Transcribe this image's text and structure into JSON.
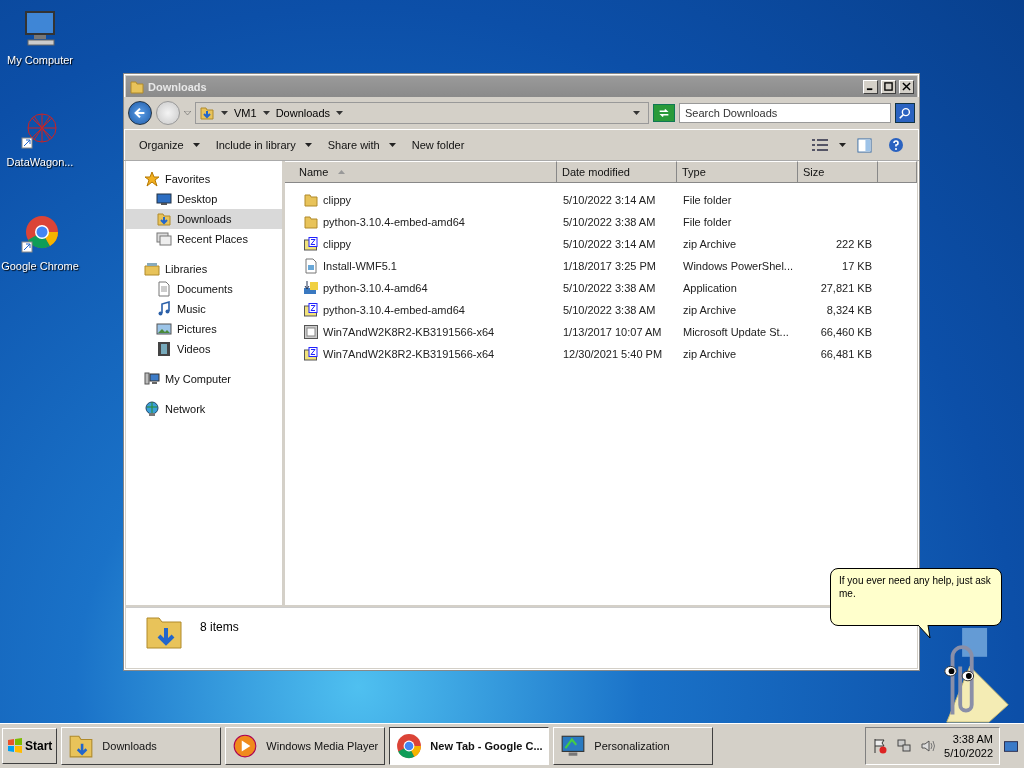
{
  "desktop_icons": [
    {
      "label": "My Computer",
      "kind": "computer"
    },
    {
      "label": "DataWagon...",
      "kind": "network-art"
    },
    {
      "label": "Google Chrome",
      "kind": "browser"
    }
  ],
  "window": {
    "title": "Downloads",
    "address": [
      "VM1",
      "Downloads"
    ],
    "search": {
      "placeholder": "Search Downloads"
    }
  },
  "toolbar": [
    {
      "label": "Organize",
      "dropdown": true
    },
    {
      "label": "Include in library",
      "dropdown": true
    },
    {
      "label": "Share with",
      "dropdown": true
    },
    {
      "label": "New folder",
      "dropdown": false
    }
  ],
  "navigation": [
    {
      "label": "Favorites",
      "kind": "star",
      "selected": false,
      "children": [
        {
          "label": "Desktop",
          "kind": "desktop",
          "selected": false
        },
        {
          "label": "Downloads",
          "kind": "downloads",
          "selected": true
        },
        {
          "label": "Recent Places",
          "kind": "recent",
          "selected": false
        }
      ]
    },
    {
      "label": "Libraries",
      "kind": "library",
      "selected": false,
      "children": [
        {
          "label": "Documents",
          "kind": "documents",
          "selected": false
        },
        {
          "label": "Music",
          "kind": "music",
          "selected": false
        },
        {
          "label": "Pictures",
          "kind": "pictures",
          "selected": false
        },
        {
          "label": "Videos",
          "kind": "videos",
          "selected": false
        }
      ]
    },
    {
      "label": "My Computer",
      "kind": "computer",
      "selected": false
    },
    {
      "label": "Network",
      "kind": "network",
      "selected": false
    }
  ],
  "columns": [
    "Name",
    "Date modified",
    "Type",
    "Size"
  ],
  "files": [
    {
      "name": "clippy",
      "date": "5/10/2022 3:14 AM",
      "type": "File folder",
      "kind": "folder"
    },
    {
      "name": "python-3.10.4-embed-amd64",
      "date": "5/10/2022 3:38 AM",
      "type": "File folder",
      "kind": "folder"
    },
    {
      "name": "clippy",
      "date": "5/10/2022 3:14 AM",
      "type": "zip Archive",
      "size": "222 KB",
      "kind": "zip"
    },
    {
      "name": "Install-WMF5.1",
      "date": "1/18/2017 3:25 PM",
      "type": "Windows PowerShel...",
      "size": "17 KB",
      "kind": "script"
    },
    {
      "name": "python-3.10.4-amd64",
      "date": "5/10/2022 3:38 AM",
      "type": "Application",
      "size": "27,821 KB",
      "kind": "installer"
    },
    {
      "name": "python-3.10.4-embed-amd64",
      "date": "5/10/2022 3:38 AM",
      "type": "zip Archive",
      "size": "8,324 KB",
      "kind": "zip"
    },
    {
      "name": "Win7AndW2K8R2-KB3191566-x64",
      "date": "1/13/2017 10:07 AM",
      "type": "Microsoft Update St...",
      "size": "66,460 KB",
      "kind": "update"
    },
    {
      "name": "Win7AndW2K8R2-KB3191566-x64",
      "date": "12/30/2021 5:40 PM",
      "type": "zip Archive",
      "size": "66,481 KB",
      "kind": "zip"
    }
  ],
  "details": {
    "count": "8 items"
  },
  "balloon": {
    "text": "If you ever need any help, just ask me."
  },
  "taskbar": {
    "start": "Start",
    "tasks": [
      {
        "label": "Downloads",
        "kind": "folder",
        "selected": false
      },
      {
        "label": "Windows Media Player",
        "kind": "media",
        "selected": false
      },
      {
        "label": "New Tab - Google C...",
        "kind": "browser",
        "selected": true
      },
      {
        "label": "Personalization",
        "kind": "display",
        "selected": false
      }
    ],
    "time": "3:38 AM",
    "date": "5/10/2022"
  }
}
